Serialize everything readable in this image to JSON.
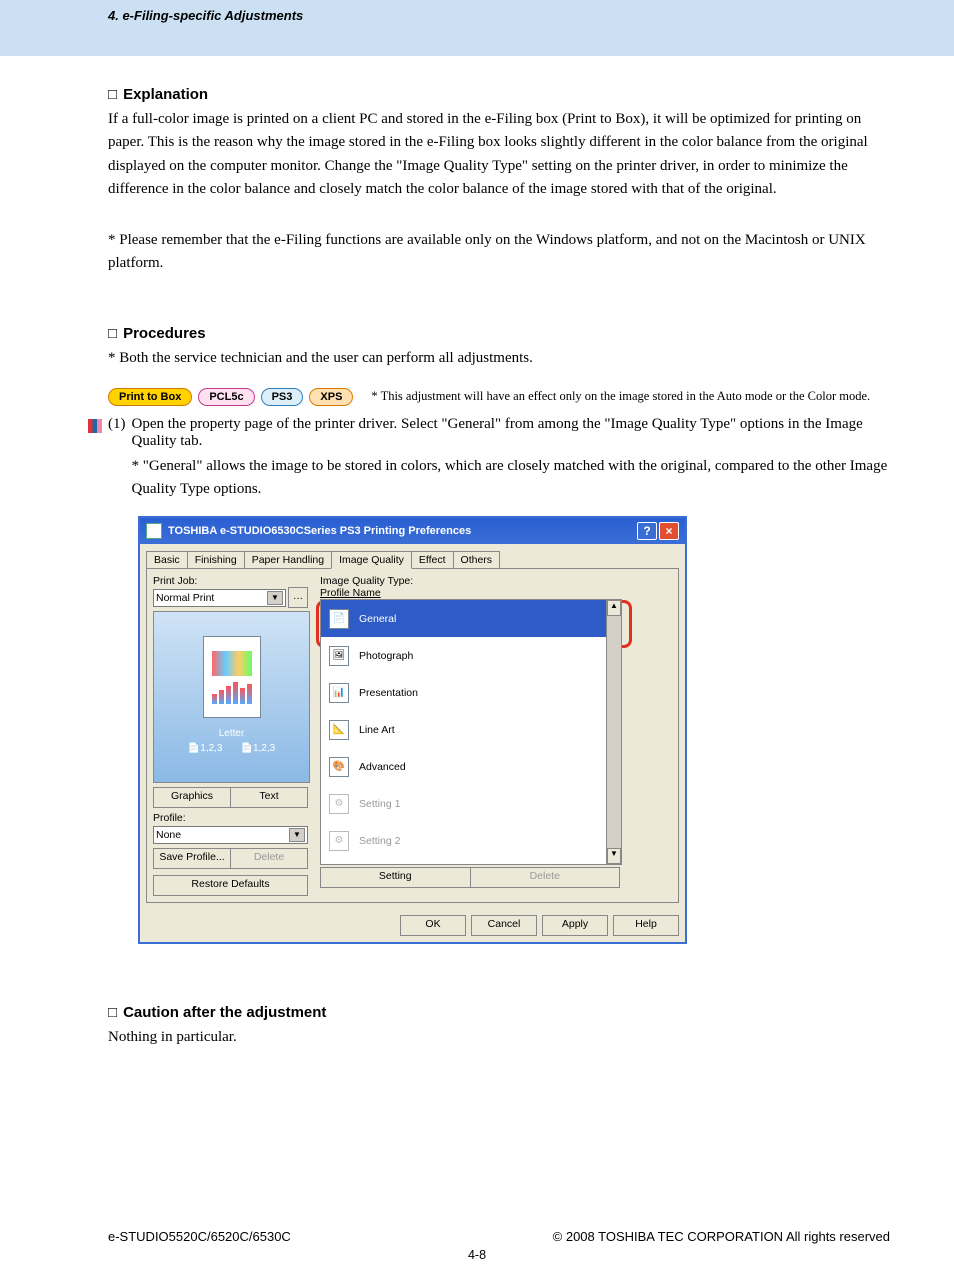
{
  "header": {
    "breadcrumb": "4. e-Filing-specific Adjustments"
  },
  "sections": {
    "explanation": {
      "title": "Explanation",
      "body": "If a full-color image is printed on a client PC and stored in the e-Filing box (Print to Box), it will be optimized for printing on paper.  This is the reason why the image stored in the e-Filing box looks slightly different in the color balance from the original displayed on the computer monitor.  Change the \"Image Quality Type\" setting on the printer driver, in order to minimize the difference in the color balance and closely match the color balance of the image stored with that of the original.",
      "note": "Please remember that the e-Filing functions are available only on the Windows platform, and not on the Macintosh or UNIX platform."
    },
    "procedures": {
      "title": "Procedures",
      "note": "Both the service technician and the user can perform all adjustments.",
      "badges": [
        "Print to Box",
        "PCL5c",
        "PS3",
        "XPS"
      ],
      "side_note": "This adjustment will have an effect only on the image stored in the Auto mode or the Color mode.",
      "step1_num": "(1)",
      "step1": "Open the property page of the printer driver.  Select \"General\" from among the \"Image Quality Type\" options in the Image Quality tab.",
      "step1_note": "\"General\" allows the image to be stored in colors, which are closely matched with the original, compared to the other Image Quality Type options."
    },
    "caution": {
      "title": "Caution after the adjustment",
      "body": "Nothing in particular."
    }
  },
  "dialog": {
    "title": "TOSHIBA e-STUDIO6530CSeries PS3 Printing Preferences",
    "tabs": [
      "Basic",
      "Finishing",
      "Paper Handling",
      "Image Quality",
      "Effect",
      "Others"
    ],
    "active_tab": 3,
    "print_job_label": "Print Job:",
    "print_job_value": "Normal Print",
    "preview_paper": "Letter",
    "preview_counts": "1,2,3",
    "res_buttons": [
      "Graphics",
      "Text"
    ],
    "profile_label": "Profile:",
    "profile_value": "None",
    "profile_buttons": [
      "Save Profile...",
      "Delete"
    ],
    "restore": "Restore Defaults",
    "iqt_label": "Image Quality Type:",
    "profile_name_label": "Profile Name",
    "iqt_items": [
      "General",
      "Photograph",
      "Presentation",
      "Line Art",
      "Advanced",
      "Setting 1",
      "Setting 2"
    ],
    "iqt_selected": 0,
    "iqt_buttons": [
      "Setting",
      "Delete"
    ],
    "footer_buttons": [
      "OK",
      "Cancel",
      "Apply",
      "Help"
    ]
  },
  "footer": {
    "left": "e-STUDIO5520C/6520C/6530C",
    "right": "© 2008 TOSHIBA TEC CORPORATION All rights reserved",
    "page": "4-8"
  }
}
